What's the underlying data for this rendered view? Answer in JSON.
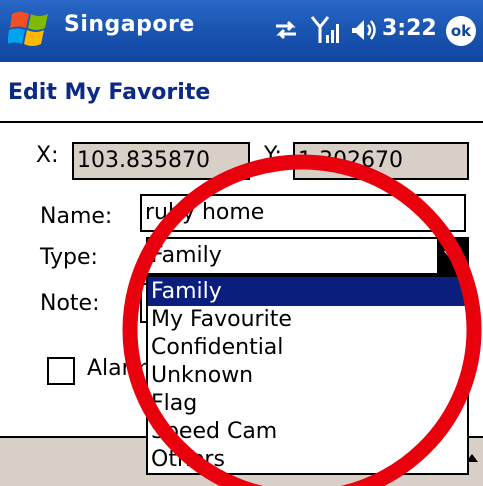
{
  "status_bar": {
    "app_title": "Singapore",
    "time": "3:22",
    "ok_label": "ok",
    "icons": [
      "windows-logo-icon",
      "sync-icon",
      "signal-icon",
      "volume-icon"
    ]
  },
  "page": {
    "title": "Edit My Favorite"
  },
  "form": {
    "x_label": "X:",
    "x_value": "103.835870",
    "y_label": "Y:",
    "y_value": "1.302670",
    "name_label": "Name:",
    "name_value": "ruby home",
    "type_label": "Type:",
    "type_value": "Family",
    "note_label": "Note:",
    "alarm_label": "Alarm",
    "alarm_checked": false
  },
  "dropdown": {
    "items": [
      "Family",
      "My Favourite",
      "Confidential",
      "Unknown",
      "Flag",
      "Speed Cam",
      "Others"
    ],
    "selected_index": 0
  },
  "colors": {
    "title_bar": "#1b56b3",
    "page_title": "#0b2a86",
    "readonly_field": "#d8cfc6",
    "selection": "#0a1f7d",
    "annotation_circle": "#e8000d"
  }
}
